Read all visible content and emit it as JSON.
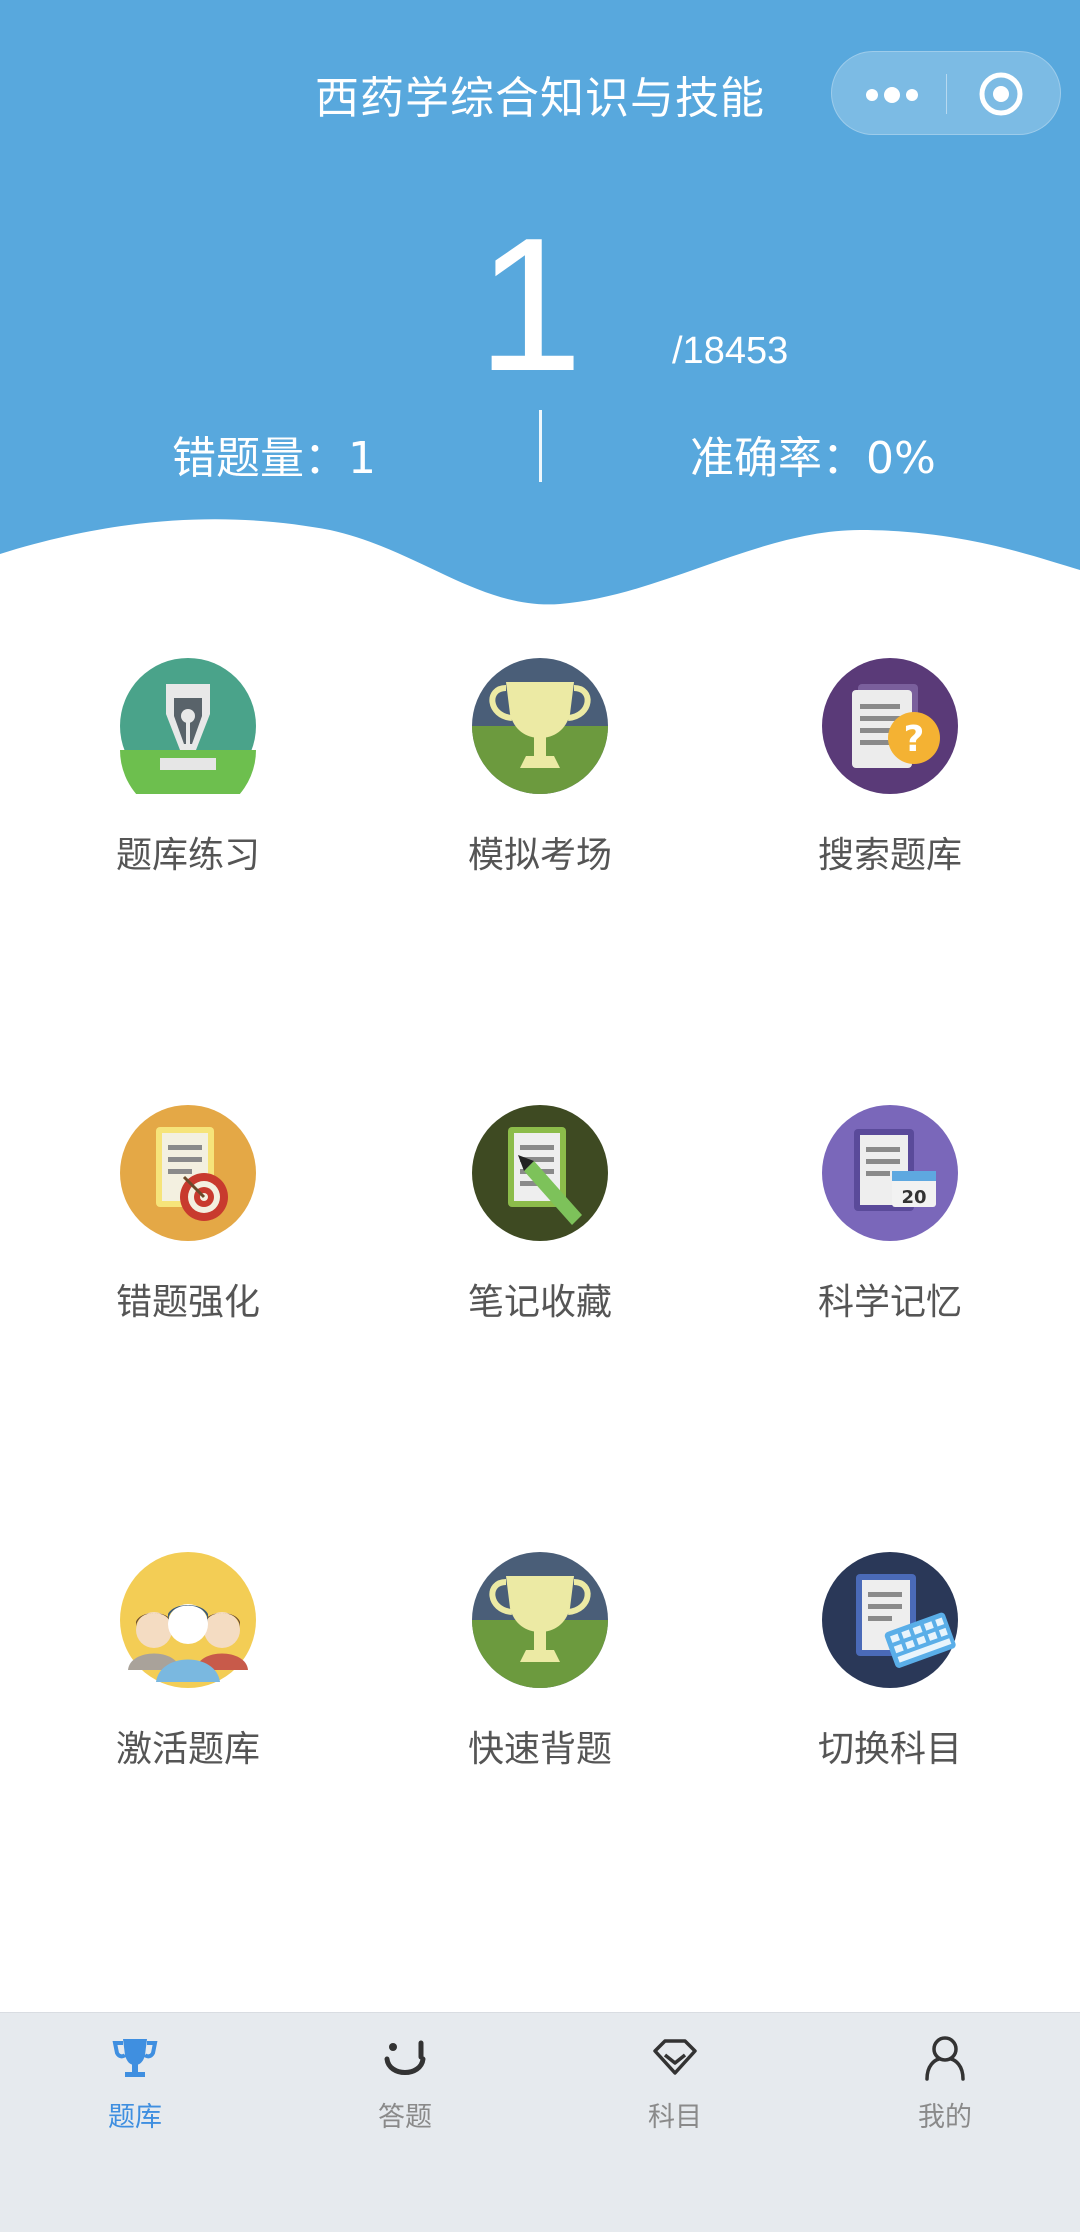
{
  "header": {
    "title": "西药学综合知识与技能",
    "done_count": "1",
    "total_count": "/18453",
    "wrong_label": "错题量：1",
    "accuracy_label": "准确率：0%",
    "bg_color": "#58a8dd"
  },
  "grid": {
    "items": [
      {
        "label": "题库练习",
        "icon": "pen-nib-icon"
      },
      {
        "label": "模拟考场",
        "icon": "trophy-icon"
      },
      {
        "label": "搜索题库",
        "icon": "document-question-icon"
      },
      {
        "label": "错题强化",
        "icon": "document-target-icon"
      },
      {
        "label": "笔记收藏",
        "icon": "document-pencil-icon"
      },
      {
        "label": "科学记忆",
        "icon": "document-calendar-icon"
      },
      {
        "label": "激活题库",
        "icon": "people-group-icon"
      },
      {
        "label": "快速背题",
        "icon": "trophy-icon"
      },
      {
        "label": "切换科目",
        "icon": "document-keyboard-icon"
      }
    ]
  },
  "tabbar": {
    "tabs": [
      {
        "label": "题库",
        "icon": "trophy-tab-icon",
        "active": true
      },
      {
        "label": "答题",
        "icon": "smile-tab-icon",
        "active": false
      },
      {
        "label": "科目",
        "icon": "diamond-tab-icon",
        "active": false
      },
      {
        "label": "我的",
        "icon": "user-tab-icon",
        "active": false
      }
    ],
    "active_color": "#3f8fe0"
  }
}
